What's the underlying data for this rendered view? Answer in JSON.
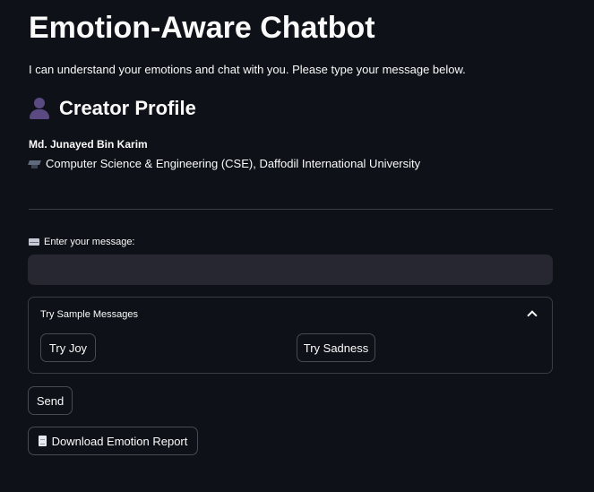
{
  "app": {
    "title": "Emotion-Aware Chatbot",
    "intro": "I can understand your emotions and chat with you. Please type your message below."
  },
  "creator": {
    "heading": "Creator Profile",
    "heading_icon": "person-silhouette-icon",
    "name": "Md. Junayed Bin Karim",
    "department_icon": "graduation-cap-icon",
    "department": "Computer Science & Engineering (CSE), Daffodil International University"
  },
  "message": {
    "label_icon": "envelope-icon",
    "label": "Enter your message:",
    "value": "",
    "placeholder": ""
  },
  "samples": {
    "header": "Try Sample Messages",
    "expanded_icon": "chevron-up-icon",
    "buttons": [
      "Try Joy",
      "Try Sadness"
    ]
  },
  "actions": {
    "send_label": "Send",
    "download_icon": "document-icon",
    "download_label": "Download Emotion Report"
  },
  "colors": {
    "background": "#0e1117",
    "input_background": "#262730",
    "border": "#3a3d46",
    "text": "#fafafa"
  }
}
